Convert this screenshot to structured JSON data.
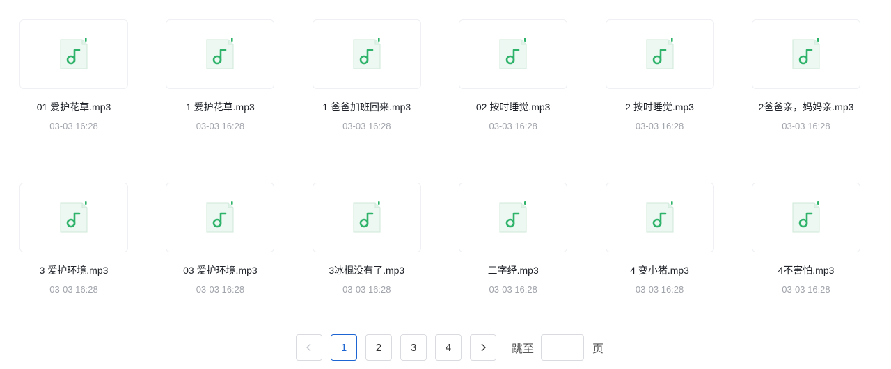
{
  "files": [
    {
      "name": "01 爱护花草.mp3",
      "time": "03-03 16:28",
      "icon": "music-file-icon"
    },
    {
      "name": "1 爱护花草.mp3",
      "time": "03-03 16:28",
      "icon": "music-file-icon"
    },
    {
      "name": "1 爸爸加班回来.mp3",
      "time": "03-03 16:28",
      "icon": "music-file-icon"
    },
    {
      "name": "02 按时睡觉.mp3",
      "time": "03-03 16:28",
      "icon": "music-file-icon"
    },
    {
      "name": "2 按时睡觉.mp3",
      "time": "03-03 16:28",
      "icon": "music-file-icon"
    },
    {
      "name": "2爸爸亲，妈妈亲.mp3",
      "time": "03-03 16:28",
      "icon": "music-file-icon"
    },
    {
      "name": "3 爱护环境.mp3",
      "time": "03-03 16:28",
      "icon": "music-file-icon"
    },
    {
      "name": "03 爱护环境.mp3",
      "time": "03-03 16:28",
      "icon": "music-file-icon"
    },
    {
      "name": "3冰棍没有了.mp3",
      "time": "03-03 16:28",
      "icon": "music-file-icon"
    },
    {
      "name": "三字经.mp3",
      "time": "03-03 16:28",
      "icon": "music-file-icon"
    },
    {
      "name": "4 变小猪.mp3",
      "time": "03-03 16:28",
      "icon": "music-file-icon"
    },
    {
      "name": "4不害怕.mp3",
      "time": "03-03 16:28",
      "icon": "music-file-icon"
    }
  ],
  "pagination": {
    "prev_icon": "chevron-left-icon",
    "next_icon": "chevron-right-icon",
    "prev_label": "<",
    "next_label": ">",
    "pages": [
      "1",
      "2",
      "3",
      "4"
    ],
    "current": "1",
    "jump_label": "跳至",
    "jump_value": "",
    "page_suffix": "页"
  },
  "colors": {
    "accent": "#1d65d2",
    "music_icon_green": "#2fb36b",
    "music_icon_bg": "#eef8f2"
  }
}
